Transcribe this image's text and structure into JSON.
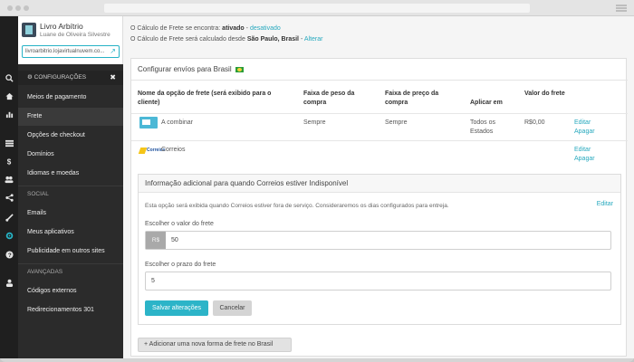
{
  "store": {
    "name": "Livro Arbítrio",
    "owner": "Luane de Oliveira Silvestre",
    "url": "livroarbitrio.lojavirtualnuvem.co..."
  },
  "sidebar": {
    "settings_header": "CONFIGURAÇÕES",
    "items_top": [
      "Meios de pagamento",
      "Frete",
      "Opções de checkout",
      "Domínios",
      "Idiomas e moedas"
    ],
    "social_label": "SOCIAL",
    "items_social": [
      "Emails",
      "Meus aplicativos",
      "Publicidade em outros sites"
    ],
    "advanced_label": "AVANÇADAS",
    "items_advanced": [
      "Códigos externos",
      "Redirecionamentos 301"
    ]
  },
  "rail_icons": [
    "search-icon",
    "home-icon",
    "stats-icon",
    "list-icon",
    "money-icon",
    "users-icon",
    "share-icon",
    "brush-icon",
    "gear-icon",
    "help-icon",
    "user-icon"
  ],
  "status": {
    "line1_prefix": "O Cálculo de Frete se encontra:",
    "line1_state": "ativado",
    "line1_sep": "-",
    "line1_link": "desativado",
    "line2_prefix": "O Cálculo de Frete será calculado desde",
    "line2_place": "São Paulo, Brasil",
    "line2_sep": "-",
    "line2_link": "Alterar"
  },
  "panel": {
    "title": "Configurar envíos para Brasil",
    "columns": [
      "Nome da opção de frete (será exibido para o cliente)",
      "Faixa de peso da compra",
      "Faixa de preço da compra",
      "Aplicar em",
      "Valor do frete"
    ],
    "rows": [
      {
        "name": "A combinar",
        "weight": "Sempre",
        "price": "Sempre",
        "apply": "Todos os Estados",
        "value": "R$0,00",
        "edit": "Editar",
        "delete": "Apagar"
      },
      {
        "name": "Correios",
        "logo_text": "Correios",
        "edit": "Editar",
        "delete": "Apagar"
      }
    ]
  },
  "subpanel": {
    "title": "Informação adicional para quando Correios estiver Indisponível",
    "description": "Esta opção será exibida quando Correios estiver fora de serviço. Consideraremos os dias configurados para entreja.",
    "edit": "Editar",
    "value_label": "Escolher o valor do frete",
    "currency": "R$",
    "value": "50",
    "days_label": "Escolher o prazo do frete",
    "days": "5",
    "save": "Salvar alterações",
    "cancel": "Cancelar"
  },
  "add_button": "+ Adicionar uma nova forma de frete no Brasil",
  "colors": {
    "accent": "#2cb4c8",
    "sidebar": "#2b2b2b",
    "rail": "#1f1f1f"
  }
}
